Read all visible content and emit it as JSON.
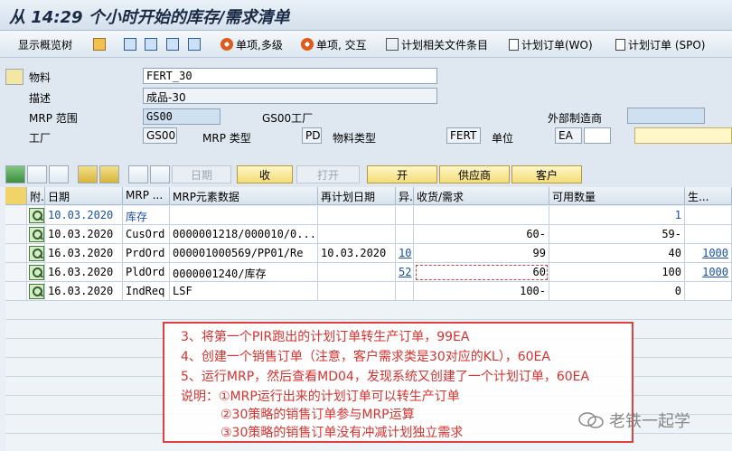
{
  "window": {
    "title": "从 14:29 个小时开始的库存/需求清单"
  },
  "toolbar": {
    "show_tree": "显示概览树",
    "single_multi": "单项,多级",
    "single_interactive": "单项, 交互",
    "plan_files": "计划相关文件条目",
    "plan_order_wo": "计划订单(WO)",
    "plan_order_spo": "计划订单 (SPO)"
  },
  "header": {
    "material_label": "物料",
    "material_value": "FERT_30",
    "desc_label": "描述",
    "desc_value": "成品-30",
    "mrp_area_label": "MRP 范围",
    "mrp_area_value": "GS00",
    "mrp_area_text": "GS00工厂",
    "ext_proc_label": "外部制造商",
    "plant_label": "工厂",
    "plant_value": "GS00",
    "mrp_type_label": "MRP 类型",
    "mrp_type_value": "PD",
    "mat_type_label": "物料类型",
    "mat_type_value": "FERT",
    "unit_label": "单位",
    "unit_value": "EA"
  },
  "buttons": {
    "date": "日期",
    "receipt": "收",
    "open": "打开",
    "open2": "开",
    "vendor": "供应商",
    "customer": "客户"
  },
  "grid": {
    "headers": [
      "附.",
      "日期",
      "MRP ...",
      "MRP元素数据",
      "再计划日期",
      "异.",
      "收货/需求",
      "可用数量",
      "生..."
    ],
    "rows": [
      {
        "date": "10.03.2020",
        "mrp": "库存",
        "data": "",
        "redate": "",
        "exc": "",
        "qty": "",
        "avail": "1",
        "prod": ""
      },
      {
        "date": "10.03.2020",
        "mrp": "CusOrd",
        "data": "0000001218/000010/0...",
        "redate": "",
        "exc": "",
        "qty": "60-",
        "avail": "59-",
        "prod": ""
      },
      {
        "date": "16.03.2020",
        "mrp": "PrdOrd",
        "data": "000001000569/PP01/Re",
        "redate": "10.03.2020",
        "exc": "10",
        "qty": "99",
        "avail": "40",
        "prod": "1000"
      },
      {
        "date": "16.03.2020",
        "mrp": "PldOrd",
        "data": "0000001240/库存",
        "redate": "",
        "exc": "52",
        "qty": "60",
        "avail": "100",
        "prod": "1000"
      },
      {
        "date": "16.03.2020",
        "mrp": "IndReq",
        "data": "LSF",
        "redate": "",
        "exc": "",
        "qty": "100-",
        "avail": "0",
        "prod": ""
      }
    ]
  },
  "annotation": {
    "lines": [
      "3、将第一个PIR跑出的计划订单转生产订单，99EA",
      "4、创建一个销售订单（注意，客户需求类是30对应的KL），60EA",
      "5、运行MRP，然后查看MD04，发现系统又创建了一个计划订单，60EA",
      "说明：①MRP运行出来的计划订单可以转生产订单",
      "②30策略的销售订单参与MRP运算",
      "③30策略的销售订单没有冲减计划独立需求"
    ]
  },
  "watermark": {
    "text": "老铁一起学"
  }
}
